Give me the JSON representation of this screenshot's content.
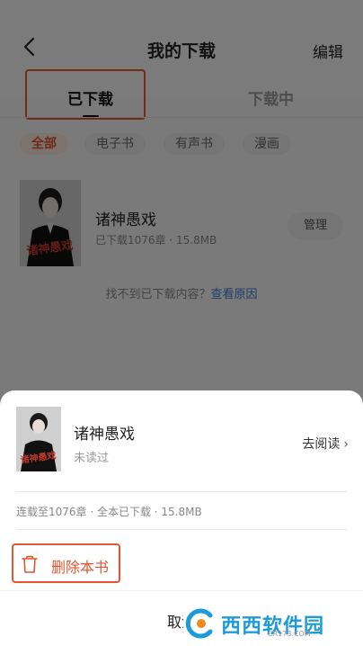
{
  "header": {
    "title": "我的下载",
    "edit_label": "编辑"
  },
  "tabs": {
    "downloaded": "已下载",
    "downloading": "下载中"
  },
  "filters": [
    "全部",
    "电子书",
    "有声书",
    "漫画"
  ],
  "book": {
    "name": "诸神愚戏",
    "meta": "已下载1076章 · 15.8MB",
    "manage_label": "管理",
    "cover_art_text": "诸神愚戏"
  },
  "notfound": {
    "text": "找不到已下载内容？",
    "link": "查看原因"
  },
  "sheet": {
    "name": "诸神愚戏",
    "status": "未读过",
    "read_label": "去阅读",
    "info": "连载至1076章 · 全本已下载 · 15.8MB",
    "delete_label": "删除本书",
    "cancel_label": "取消"
  },
  "watermark": {
    "brand": "西西软件园",
    "url": "CR173.COM"
  },
  "colors": {
    "accent": "#e05426",
    "highlight_box": "#e2572f",
    "link": "#3a7bd5"
  }
}
